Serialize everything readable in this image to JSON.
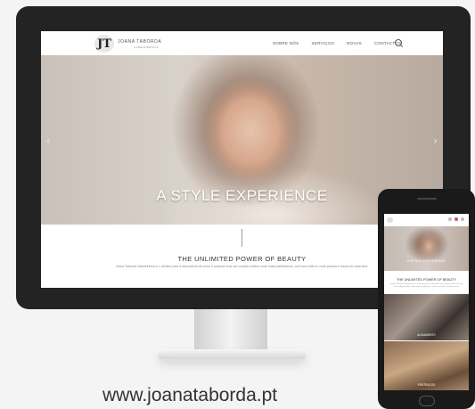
{
  "desktop": {
    "logo": {
      "mark": "JT",
      "name": "JOANA TABORDA",
      "subtitle": "CABELEIREIROS"
    },
    "nav": [
      "SOBRE NÓS",
      "SERVIÇOS",
      "NOVAS",
      "CONTACTOS"
    ],
    "hero": {
      "title": "A STYLE EXPERIENCE",
      "prev_arrow": "‹",
      "next_arrow": "›"
    },
    "intro": {
      "tagline": "THE UNLIMITED POWER OF BEAUTY",
      "description": "Joana Taborda Cabeleireiros é o destino para a descoberta de como é possível criar um cuidado melhor onde todos partilhamos, com foco total no cada pessoa e traços de cada face."
    }
  },
  "phone": {
    "hero_title": "A STYLE EXPERIENCE",
    "tagline": "THE UNLIMITED POWER OF BEAUTY",
    "description": "Joana Taborda Cabeleireiros é o destino para a descoberta de como é possível criar um cuidado melhor onde todos partilhamos, com foco total no cada pessoa.",
    "caption1": "ALISAMENTO",
    "caption2": "PENTEADOS"
  },
  "url": "www.joanataborda.pt"
}
